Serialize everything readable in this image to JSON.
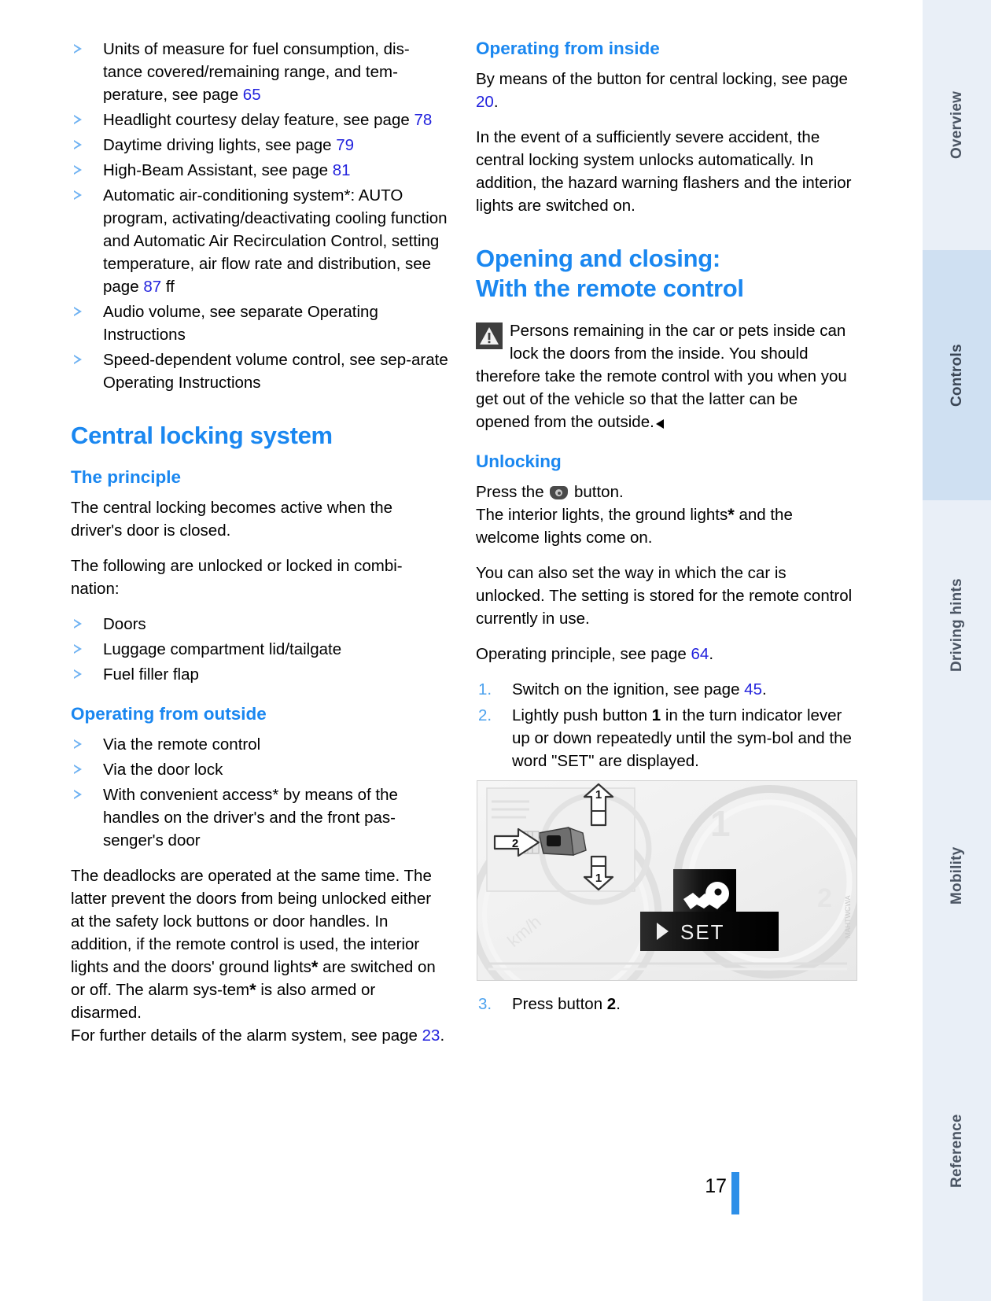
{
  "page": {
    "number": "17",
    "accent_blue": "#1a87f0",
    "link_blue": "#2222dd",
    "bullet_blue": "#6fb2f2"
  },
  "left_column": {
    "carryover_bullets": [
      {
        "text_before": "Units of measure for fuel consumption, dis-tance covered/remaining range, and tem-perature, see page ",
        "page_ref": "65",
        "text_after": ""
      },
      {
        "text_before": "Headlight courtesy delay feature, see page ",
        "page_ref": "78",
        "text_after": ""
      },
      {
        "text_before": "Daytime driving lights, see page ",
        "page_ref": "79",
        "text_after": ""
      },
      {
        "text_before": "High-Beam Assistant, see page ",
        "page_ref": "81",
        "text_after": ""
      },
      {
        "text_before": "Automatic air-conditioning system*: AUTO program, activating/deactivating cooling function and Automatic Air Recirculation Control, setting temperature, air flow rate and distribution, see page ",
        "page_ref": "87",
        "text_after": " ff"
      },
      {
        "text_before": "Audio volume, see separate Operating Instructions",
        "page_ref": "",
        "text_after": ""
      },
      {
        "text_before": "Speed-dependent volume control, see sep-arate Operating Instructions",
        "page_ref": "",
        "text_after": ""
      }
    ],
    "central_locking_title": "Central locking system",
    "principle_title": "The principle",
    "principle_para_1": "The central locking becomes active when the driver's door is closed.",
    "principle_para_2": "The following are unlocked or locked in combi-nation:",
    "principle_bullets": [
      "Doors",
      "Luggage compartment lid/tailgate",
      "Fuel filler flap"
    ],
    "outside_title": "Operating from outside",
    "outside_bullets": [
      "Via the remote control",
      "Via the door lock",
      "With convenient access* by means of the handles on the driver's and the front pas-senger's door"
    ],
    "deadlocks_para_start": "The deadlocks are operated at the same time. The latter prevent the doors from being unlocked either at the safety lock buttons or door handles. In addition, if the remote control is used, the interior lights and the doors' ground lights",
    "deadlocks_para_mid": " are switched on or off. The alarm sys-tem",
    "deadlocks_para_end": " is also armed or disarmed.",
    "alarm_ref_before": "For further details of the alarm system, see page ",
    "alarm_ref_page": "23",
    "alarm_ref_after": "."
  },
  "right_column": {
    "inside_title": "Operating from inside",
    "inside_para_1_before": "By means of the button for central locking, see page ",
    "inside_para_1_page": "20",
    "inside_para_1_after": ".",
    "inside_para_2": "In the event of a sufficiently severe accident, the central locking system unlocks automatically. In addition, the hazard warning flashers and the interior lights are switched on.",
    "opening_title_line1": "Opening and closing:",
    "opening_title_line2": "With the remote control",
    "warning_text": "Persons remaining in the car or pets inside can lock the doors from the inside. You should therefore take the remote control with you when you get out of the vehicle so that the latter can be opened from the outside.",
    "unlocking_title": "Unlocking",
    "unlocking_press_before": "Press the ",
    "unlocking_press_after": " button.",
    "unlocking_para_1_before": "The interior lights, the ground lights",
    "unlocking_para_1_after": " and the welcome lights come on.",
    "unlocking_para_2": "You can also set the way in which the car is unlocked. The setting is stored for the remote control currently in use.",
    "operating_principle_before": "Operating principle, see page ",
    "operating_principle_page": "64",
    "operating_principle_after": ".",
    "steps": [
      {
        "num": "1.",
        "text_before": "Switch on the ignition, see page ",
        "page_ref": "45",
        "text_after": "."
      },
      {
        "num": "2.",
        "text_before": "Lightly push button ",
        "bold": "1",
        "text_after": " in the turn indicator lever up or down repeatedly until the sym-bol and the word \"SET\" are displayed."
      },
      {
        "num": "3.",
        "text_before": "Press button ",
        "bold": "2",
        "text_after": "."
      }
    ],
    "figure": {
      "callout_up": "1",
      "callout_side": "2",
      "callout_down": "1",
      "display_label": "SET"
    }
  },
  "side_tabs": [
    {
      "label": "Overview",
      "active": false
    },
    {
      "label": "Controls",
      "active": true
    },
    {
      "label": "Driving hints",
      "active": false
    },
    {
      "label": "Mobility",
      "active": false
    },
    {
      "label": "Reference",
      "active": false
    }
  ]
}
